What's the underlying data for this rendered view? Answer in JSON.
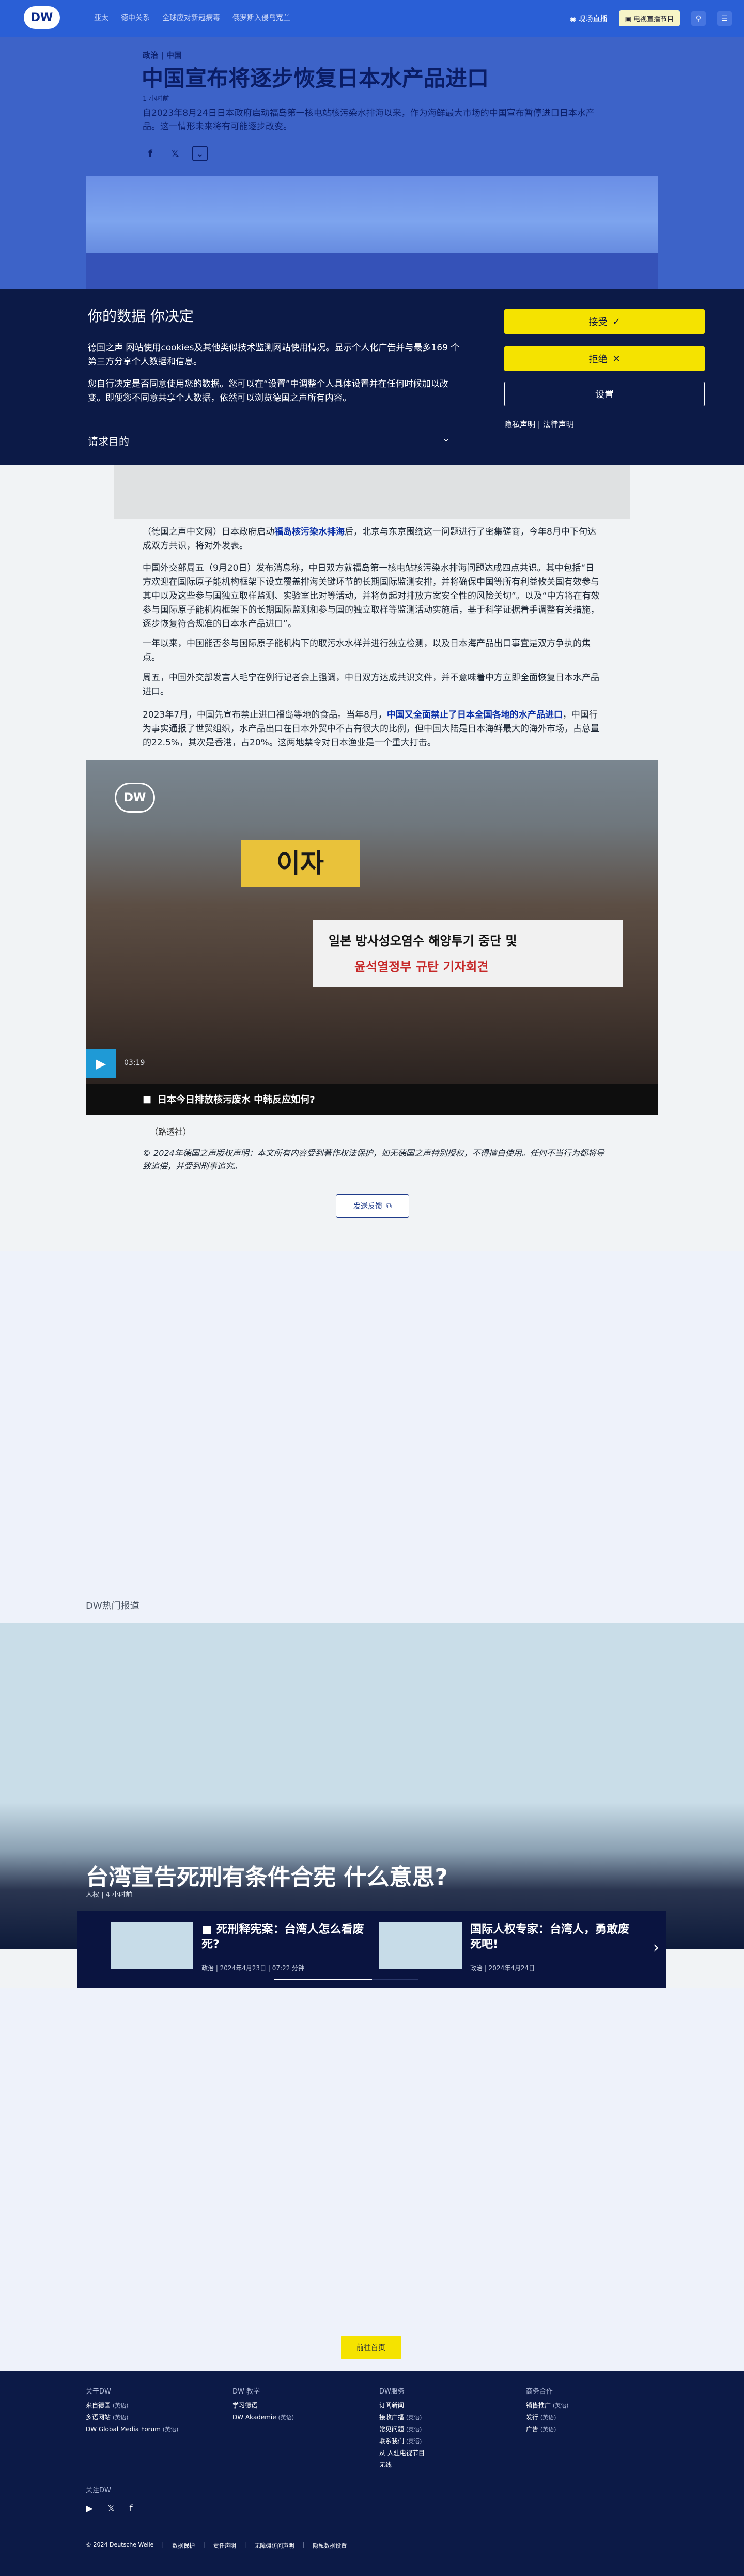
{
  "nav": {
    "logo": "DW",
    "links": [
      "亚太",
      "德中关系",
      "全球应对新冠病毒",
      "俄罗斯入侵乌克兰"
    ],
    "live_label": "现场直播",
    "lang_label": "电视直播节目",
    "menu_icon": "grid-icon"
  },
  "article": {
    "breadcrumb": "政治 | 中国",
    "title": "中国宣布将逐步恢复日本水产品进口",
    "meta": "1 小时前",
    "lead": "自2023年8月24日日本政府启动福岛第一核电站核污染水排海以来，作为海鲜最大市场的中国宣布暂停进口日本水产品。这一情形未来将有可能逐步改变。",
    "paragraphs": [
      {
        "before": "（德国之声中文网）日本政府启动",
        "link": "福岛核污染水排海",
        "after": "后，北京与东京围绕这一问题进行了密集磋商，今年8月中下旬达成双方共识，将对外发表。"
      },
      {
        "before": "中国外交部周五（9月20日）发布消息称，中日双方就福岛第一核电站核污染水排海问题达成四点共识。其中包括“日方欢迎在国际原子能机构框架下设立覆盖排海关键环节的长期国际监测安排，并将确保中国等所有利益攸关国有效参与其中以及这些参与国独立取样监测、实验室比对等活动，并将负起对排放方案安全性的风险关切”。以及“中方将在有效参与国际原子能机构框架下的长期国际监测和参与国的独立取样等监测活动实施后，基于科学证据着手调整有关措施，逐步恢复符合规准的日本水产品进口”。",
        "link": "",
        "after": ""
      },
      {
        "before": "一年以来，中国能否参与国际原子能机构下的取污水水样并进行独立检测，以及日本海产品出口事宜是双方争执的焦点。",
        "link": "",
        "after": ""
      },
      {
        "before": "周五，中国外交部发言人毛宁在例行记者会上强调，中日双方达成共识文件，并不意味着中方立即全面恢复日本水产品进口。",
        "link": "",
        "after": ""
      },
      {
        "before": "2023年7月，中国先宣布禁止进口福岛等地的食品。当年8月，",
        "link": "中国又全面禁止了日本全国各地的水产品进口",
        "after": "，中国行为事实通报了世贸组织，水产品出口在日本外贸中不占有很大的比例，但中国大陆是日本海鲜最大的海外市场，占总量的22.5%，其次是香港，占20%。这两地禁令对日本渔业是一个重大打击。"
      }
    ],
    "video_duration": "03:19",
    "video_caption": "日本今日排放核污废水 中韩反应如何?",
    "video_logo": "DW",
    "video_banner_line1": "일본 방사성오염수 해양투기 중단 및",
    "video_banner_line2": "윤석열정부 규탄 기자회견",
    "video_sign": "이자",
    "source": "（路透社）",
    "copyright": "© 2024年德国之声版权声明：本文所有内容受到著作权法保护，如无德国之声特别授权，不得擅自使用。任何不当行为都将导致追偿，并受到刑事追究。",
    "feedback_label": "发送反馈"
  },
  "consent": {
    "title": "你的数据 你决定",
    "p1": "德国之声 网站使用cookies及其他类似技术监测网站使用情况。显示个人化广告并与最多169 个第三方分享个人数据和信息。",
    "p2": "您自行决定是否同意使用您的数据。您可以在“设置”中调整个人具体设置并在任何时候加以改变。即便您不同意共享个人数据，依然可以浏览德国之声所有内容。",
    "purpose_label": "请求目的",
    "accept_label": "接受",
    "decline_label": "拒绝",
    "settings_label": "设置",
    "privacy_link": "隐私声明",
    "legal_link": "法律声明"
  },
  "hot": {
    "label": "DW热门报道",
    "title": "台湾宣告死刑有条件合宪 什么意思?",
    "meta": "人权 | 4 小时前",
    "cards": [
      {
        "title": "死刑释宪案：台湾人怎么看废死?",
        "meta": "政治 | 2024年4月23日 | 07:22 分钟"
      },
      {
        "title": "国际人权专家：台湾人，勇敢废死吧!",
        "meta": "政治 | 2024年4月24日"
      }
    ]
  },
  "home_button": "前往首页",
  "footer": {
    "cols": [
      {
        "head": "关于DW",
        "items": [
          {
            "t": "来自德国",
            "s": "(英语)"
          },
          {
            "t": "多语网站",
            "s": "(英语)"
          },
          {
            "t": "DW Global Media Forum",
            "s": "(英语)"
          }
        ]
      },
      {
        "head": "DW 教学",
        "items": [
          {
            "t": "学习德语",
            "s": ""
          },
          {
            "t": "DW Akademie",
            "s": "(英语)"
          }
        ]
      },
      {
        "head": "DW服务",
        "items": [
          {
            "t": "订阅新闻",
            "s": ""
          },
          {
            "t": "接收广播",
            "s": "(英语)"
          },
          {
            "t": "常见问题",
            "s": "(英语)"
          },
          {
            "t": "联系我们",
            "s": "(英语)"
          },
          {
            "t": "从 人驻电视节目",
            "s": ""
          },
          {
            "t": "无线",
            "s": ""
          }
        ]
      },
      {
        "head": "商务合作",
        "items": [
          {
            "t": "销售推广",
            "s": "(英语)"
          },
          {
            "t": "发行",
            "s": "(英语)"
          },
          {
            "t": "广告",
            "s": "(英语)"
          }
        ]
      }
    ],
    "follow": "关注DW",
    "social": [
      "youtube-icon",
      "x-icon",
      "facebook-icon"
    ],
    "legal": [
      "© 2024 Deutsche Welle",
      "数据保护",
      "责任声明",
      "无障碍访问声明",
      "隐私数据设置"
    ]
  }
}
